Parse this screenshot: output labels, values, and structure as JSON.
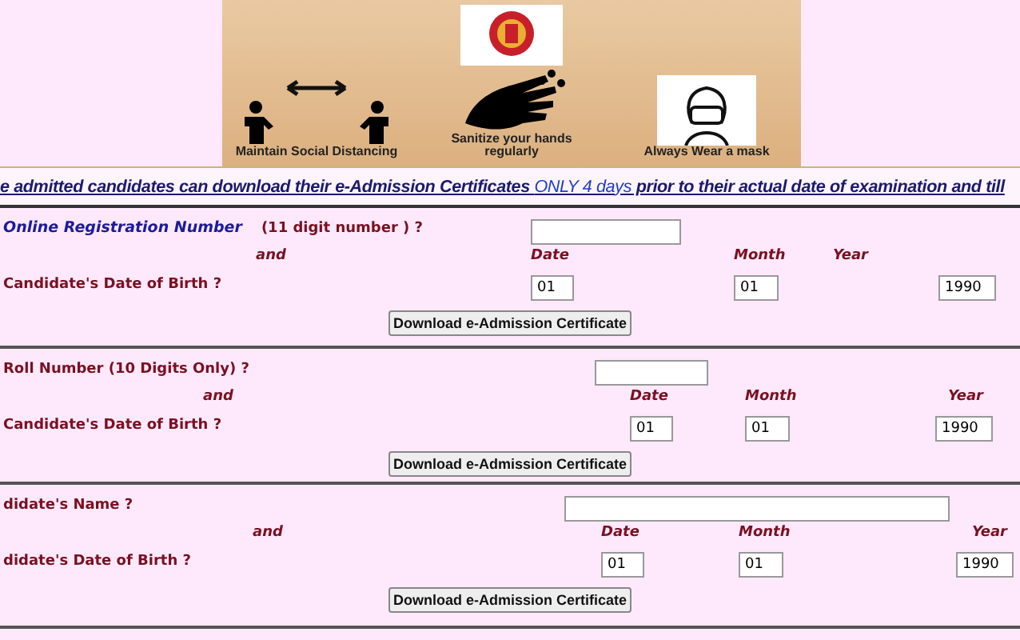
{
  "banner": {
    "captions": [
      {
        "kind": "distancing",
        "text": "Maintain Social Distancing"
      },
      {
        "kind": "sanitize",
        "text": "Sanitize your hands regularly"
      },
      {
        "kind": "mask",
        "text": "Always Wear a mask"
      }
    ]
  },
  "notice": {
    "before": "e admitted candidates can download their e-Admission Certificates ",
    "link": "ONLY 4 days",
    "after": " prior to their actual date of examination and till"
  },
  "forms": [
    {
      "label": "Online Registration Number",
      "hint": "(11 digit number ) ?",
      "and": "and",
      "date_label": "Date",
      "month_label": "Month",
      "year_label": "Year",
      "dob_label": "Candidate's Date of Birth ?",
      "date": "01",
      "month": "01",
      "year": "1990",
      "button": "Download e-Admission Certificate"
    },
    {
      "label": "Roll Number  (10 Digits Only) ?",
      "and": "and",
      "date_label": "Date",
      "month_label": "Month",
      "year_label": "Year",
      "dob_label": "Candidate's Date of Birth ?",
      "date": "01",
      "month": "01",
      "year": "1990",
      "button": "Download e-Admission Certificate"
    },
    {
      "label": "didate's Name ?",
      "and": "and",
      "date_label": "Date",
      "month_label": "Month",
      "year_label": "Year",
      "dob_label": "didate's Date of Birth ?",
      "date": "01",
      "month": "01",
      "year": "1990",
      "button": "Download e-Admission Certificate"
    }
  ]
}
